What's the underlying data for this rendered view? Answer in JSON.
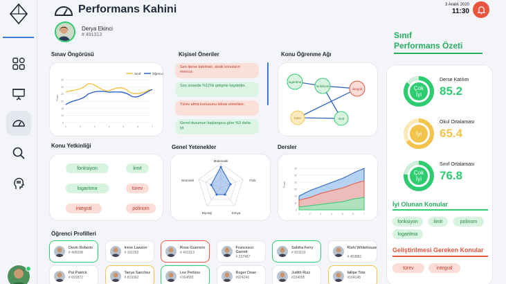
{
  "header": {
    "title": "Performans Kahini",
    "date": "3 Aralık 2020",
    "time": "11:30"
  },
  "student": {
    "name": "Derya Ekinci",
    "id": "# 491313"
  },
  "sections": {
    "exam": "Sınav Öngörüsü",
    "suggestions": "Kişisel Öneriler",
    "network": "Konu Öğrenme Ağı",
    "competence": "Konu Yetkinliği",
    "abilities": "Genel Yetenekler",
    "lessons": "Dersler",
    "profiles": "Öğrenci Profilleri"
  },
  "exam_chart": {
    "legend": [
      "Sınıf",
      "Öğrenci"
    ],
    "ylabel": "Puan",
    "yticks": [
      "35",
      "30",
      "25",
      "20",
      "15",
      "10",
      "5"
    ],
    "xticks": [
      "1",
      "2",
      "3",
      "4",
      "5",
      "6",
      "7"
    ],
    "colors": {
      "sinif": "#f5c343",
      "ogrenci": "#2b64c4"
    }
  },
  "suggestions": [
    {
      "text": "Sen derse katılmalı, eksik konuların mevcut.",
      "kind": "r"
    },
    {
      "text": "Son sınavda %12'lik gelişme kaydettin.",
      "kind": "g"
    },
    {
      "text": "Türev alma konusunu tekrar etmelisin.",
      "kind": "r"
    },
    {
      "text": "Genel durumun başlangıca göre %3 daha iyi.",
      "kind": "g"
    }
  ],
  "network": {
    "nodes": [
      "logaritma",
      "fonksiyon",
      "integral",
      "türev",
      "limit"
    ]
  },
  "competence": [
    "fonksiyon",
    "limit",
    "logaritma",
    "türev",
    "integral",
    "polinom"
  ],
  "radar": {
    "axes": [
      "Matematik",
      "Fizik",
      "Kimya",
      "Biyoloji",
      "Geometri"
    ]
  },
  "lessons_chart": {
    "ylabel": "Puan",
    "yticks": [
      "35",
      "30",
      "25",
      "20",
      "15",
      "10",
      "5"
    ],
    "xticks": [
      "1",
      "2",
      "3",
      "4",
      "5",
      "6",
      "7"
    ]
  },
  "profiles": [
    {
      "name": "Devin Roberts",
      "id": "# 405298",
      "status": "g"
    },
    {
      "name": "Irene Lawson",
      "id": "# 161293",
      "status": "n"
    },
    {
      "name": "Rose Guerrero",
      "id": "# 491313",
      "status": "r"
    },
    {
      "name": "Francesco Garrett",
      "id": "# 337487",
      "status": "n"
    },
    {
      "name": "Sabiha Ferry",
      "id": "# 931102",
      "status": "g"
    },
    {
      "name": "Rishi Whitehouse",
      "id": "# 453881",
      "status": "n"
    },
    {
      "name": "Pat Patrick",
      "id": "# 691872",
      "status": "n"
    },
    {
      "name": "Tanya Sanchez",
      "id": "# 819362",
      "status": "y"
    },
    {
      "name": "Lee Perkins",
      "id": "#164593",
      "status": "g"
    },
    {
      "name": "Roger Dean",
      "id": "#924243",
      "status": "n"
    },
    {
      "name": "Judith Ruiz",
      "id": "#234095",
      "status": "n"
    },
    {
      "name": "fallipe Tote",
      "id": "#164148",
      "status": "y"
    }
  ],
  "summary": {
    "title_line1": "Sınıf",
    "title_line2": "Performans Özeti",
    "stats": [
      {
        "label": "Derse Katılım",
        "value": "85.2",
        "grade": "Çok İyi",
        "color": "#2ecc71",
        "percent": 85.2
      },
      {
        "label": "Okul Ortalaması",
        "value": "65.4",
        "grade": "İyi",
        "color": "#f3c44b",
        "percent": 65.4
      },
      {
        "label": "Sınıf Ortalaması",
        "value": "76.8",
        "grade": "Çok İyi",
        "color": "#2ecc71",
        "percent": 76.8
      }
    ],
    "good_title": "İyi Olunan Konular",
    "good": [
      "fonksiyon",
      "limit",
      "polinom",
      "logaritma"
    ],
    "improve_title": "Geliştirilmesi Gereken Konular",
    "improve": [
      "türev",
      "integral"
    ]
  }
}
